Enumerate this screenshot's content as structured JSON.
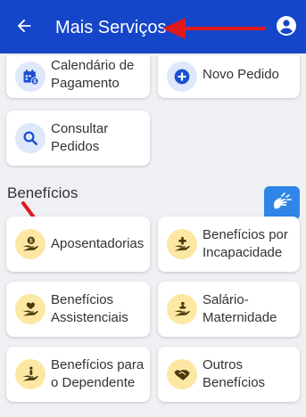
{
  "appbar": {
    "title": "Mais Serviços",
    "back_icon": "arrow-left-icon",
    "profile_icon": "account-circle-icon"
  },
  "services": [
    {
      "label": "Calendário de Pagamento",
      "icon": "calendar-money-icon"
    },
    {
      "label": "Novo Pedido",
      "icon": "plus-circle-icon"
    },
    {
      "label": "Consultar Pedidos",
      "icon": "search-icon"
    }
  ],
  "benefits": {
    "title": "Benefícios",
    "items": [
      {
        "label": "Aposentadorias",
        "icon": "hand-coin-icon"
      },
      {
        "label": "Benefícios por Incapacidade",
        "icon": "hand-plus-icon"
      },
      {
        "label": "Benefícios Assistenciais",
        "icon": "hand-heart-icon"
      },
      {
        "label": "Salário-Maternidade",
        "icon": "hand-baby-icon"
      },
      {
        "label": "Benefícios para o Dependente",
        "icon": "hand-person-icon"
      },
      {
        "label": "Outros Benefícios",
        "icon": "handshake-icon"
      }
    ]
  },
  "accessibility": {
    "icon": "sign-language-icon"
  },
  "colors": {
    "appbar": "#1545c8",
    "accent_blue": "#1a4fd0",
    "icon_yellow_bg": "#fde8a3",
    "icon_yellow_fg": "#4a3a10",
    "annotation_red": "#e0191b"
  }
}
